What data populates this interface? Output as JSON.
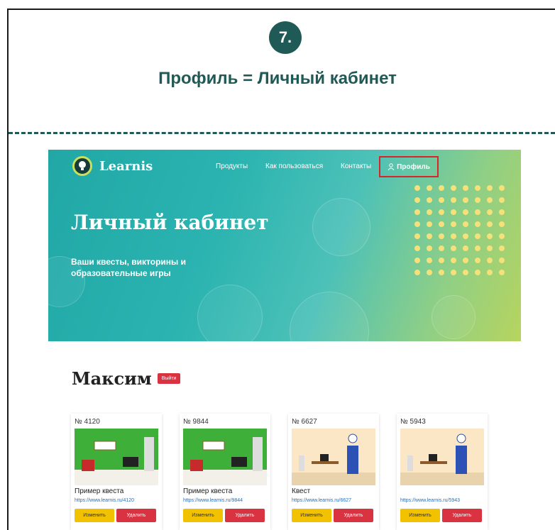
{
  "step": {
    "number": "7.",
    "title": "Профиль = Личный кабинет"
  },
  "site": {
    "logo_text": "Learnis",
    "nav": [
      "Продукты",
      "Как пользоваться",
      "Контакты"
    ],
    "nav_profile": "Профиль",
    "hero_title": "Личный кабинет",
    "hero_subtitle": "Ваши квесты, викторины и образовательные игры",
    "user_name": "Максим",
    "logout_label": "Выйти",
    "cards": [
      {
        "number": "№ 4120",
        "name": "Пример квеста",
        "url": "https://www.learnis.ru/4120",
        "edit": "Изменить",
        "delete": "Удалить",
        "scene": "green"
      },
      {
        "number": "№ 9844",
        "name": "Пример квеста",
        "url": "https://www.learnis.ru/9844",
        "edit": "Изменить",
        "delete": "Удалить",
        "scene": "green"
      },
      {
        "number": "№ 6627",
        "name": "Квест",
        "url": "https://www.learnis.ru/6627",
        "edit": "Изменить",
        "delete": "Удалить",
        "scene": "beige"
      },
      {
        "number": "№ 5943",
        "name": "",
        "url": "https://www.learnis.ru/5943",
        "edit": "Изменить",
        "delete": "Удалить",
        "scene": "beige"
      }
    ]
  },
  "colors": {
    "accent": "#1f5a56",
    "highlight": "#d6262b",
    "edit": "#f2c200",
    "delete": "#d93342"
  }
}
